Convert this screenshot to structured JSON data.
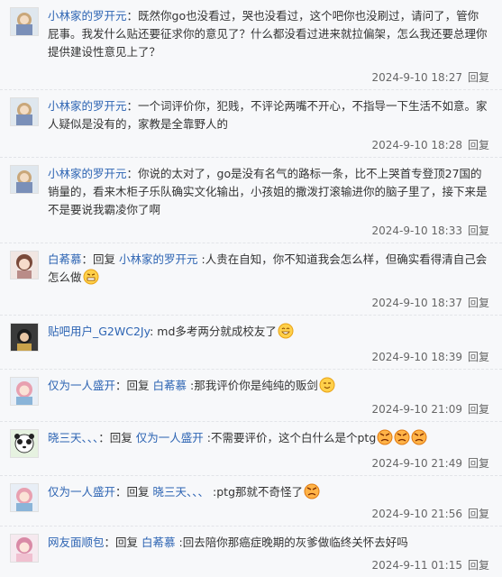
{
  "replies": [
    {
      "user": "小林家的罗开元",
      "text": "既然你go也没看过，哭也没看过，这个吧你也没刷过，请问了，管你屁事。我发什么贴还要征求你的意见了？什么都没看过进来就拉偏架，怎么我还要总理你提供建设性意见上了？",
      "time": "2024-9-10 18:27",
      "reply_label": "回复"
    },
    {
      "user": "小林家的罗开元",
      "text": "一个词评价你，犯贱，不评论两嘴不开心，不指导一下生活不如意。家人疑似是没有的，家教是全靠野人的",
      "time": "2024-9-10 18:28",
      "reply_label": "回复"
    },
    {
      "user": "小林家的罗开元",
      "text": "你说的太对了，go是没有名气的路标一条，比不上哭首专登顶27国的销量的，看来木柜子乐队确实文化输出，小孩姐的撒泼打滚输进你的脑子里了，接下来是不是要说我霸凌你了啊",
      "time": "2024-9-10 18:33",
      "reply_label": "回复"
    },
    {
      "user": "白莃慕",
      "reply_prefix": "回复",
      "target": "小林家的罗开元",
      "text": ":人贵在自知，你不知道我会怎么样，但确实看得清自己会怎么做",
      "time": "2024-9-10 18:37",
      "reply_label": "回复"
    },
    {
      "user": "贴吧用户_G2WC2Jy",
      "text": "md多考两分就成校友了",
      "time": "2024-9-10 18:39",
      "reply_label": "回复"
    },
    {
      "user": "仅为一人盛开",
      "reply_prefix": "回复",
      "target": "白莃慕",
      "text": ":那我评价你是纯纯的贩剑",
      "time": "2024-9-10 21:09",
      "reply_label": "回复"
    },
    {
      "user": "晓三天、、、",
      "reply_prefix": "回复",
      "target": "仅为一人盛开",
      "text": ":不需要评价，这个白什么是个ptg",
      "time": "2024-9-10 21:49",
      "reply_label": "回复"
    },
    {
      "user": "仅为一人盛开",
      "reply_prefix": "回复",
      "target": "晓三天、、、",
      "text": ":ptg那就不奇怪了",
      "time": "2024-9-10 21:56",
      "reply_label": "回复"
    },
    {
      "user": "网友面顺包",
      "reply_prefix": "回复",
      "target": "白莃慕",
      "text": ":回去陪你那癌症晚期的灰爹做临终关怀去好吗",
      "time": "2024-9-11 01:15",
      "reply_label": "回复"
    }
  ],
  "icons": {
    "emoji_grimace": "grimace-emoji-icon",
    "emoji_angry": "angry-emoji-icon",
    "emoji_laugh": "laugh-emoji-icon",
    "emoji_smug": "smug-emoji-icon"
  },
  "colors": {
    "username": "#2d64b3",
    "text": "#333333",
    "meta": "#666666",
    "background": "#f7f8fa"
  }
}
